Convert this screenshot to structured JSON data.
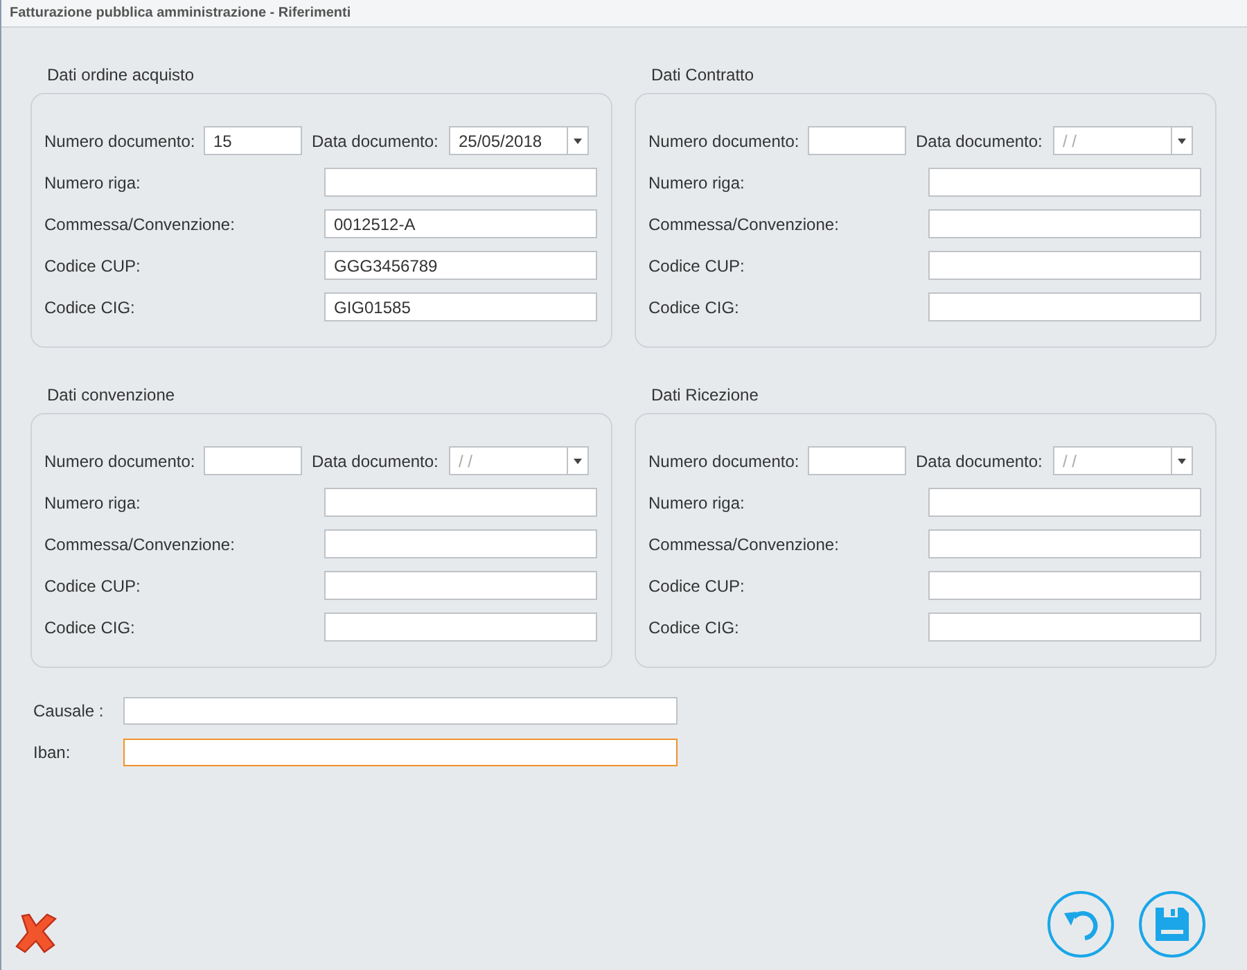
{
  "window": {
    "title": "Fatturazione pubblica amministrazione - Riferimenti"
  },
  "sections": [
    {
      "title": "Dati ordine acquisto",
      "number": {
        "label": "Numero documento:",
        "value": "15"
      },
      "date": {
        "label": "Data documento:",
        "value": "25/05/2018"
      },
      "fields": [
        {
          "label": "Numero riga:"
        },
        {
          "label": "Commessa/Convenzione:",
          "value": "0012512-A"
        },
        {
          "label": "Codice CUP:",
          "value": "GGG3456789"
        },
        {
          "label": "Codice CIG:",
          "value": "GIG01585"
        }
      ]
    },
    {
      "title": "Dati Contratto",
      "number": {
        "label": "Numero documento:"
      },
      "date": {
        "label": "Data documento:",
        "placeholder": "/ /"
      },
      "fields": [
        {
          "label": "Numero riga:"
        },
        {
          "label": "Commessa/Convenzione:"
        },
        {
          "label": "Codice CUP:"
        },
        {
          "label": "Codice CIG:"
        }
      ]
    },
    {
      "title": "Dati convenzione",
      "number": {
        "label": "Numero documento:"
      },
      "date": {
        "label": "Data documento:",
        "placeholder": "/ /"
      },
      "fields": [
        {
          "label": "Numero riga:"
        },
        {
          "label": "Commessa/Convenzione:"
        },
        {
          "label": "Codice CUP:"
        },
        {
          "label": "Codice CIG:"
        }
      ]
    },
    {
      "title": "Dati Ricezione",
      "number": {
        "label": "Numero documento:"
      },
      "date": {
        "label": "Data documento:",
        "placeholder": "/ /"
      },
      "fields": [
        {
          "label": "Numero riga:"
        },
        {
          "label": "Commessa/Convenzione:"
        },
        {
          "label": "Codice CUP:"
        },
        {
          "label": "Codice CIG:"
        }
      ]
    }
  ],
  "bottom_fields": [
    {
      "label": "Causale :",
      "focused": false
    },
    {
      "label": "Iban:",
      "focused": true
    }
  ]
}
